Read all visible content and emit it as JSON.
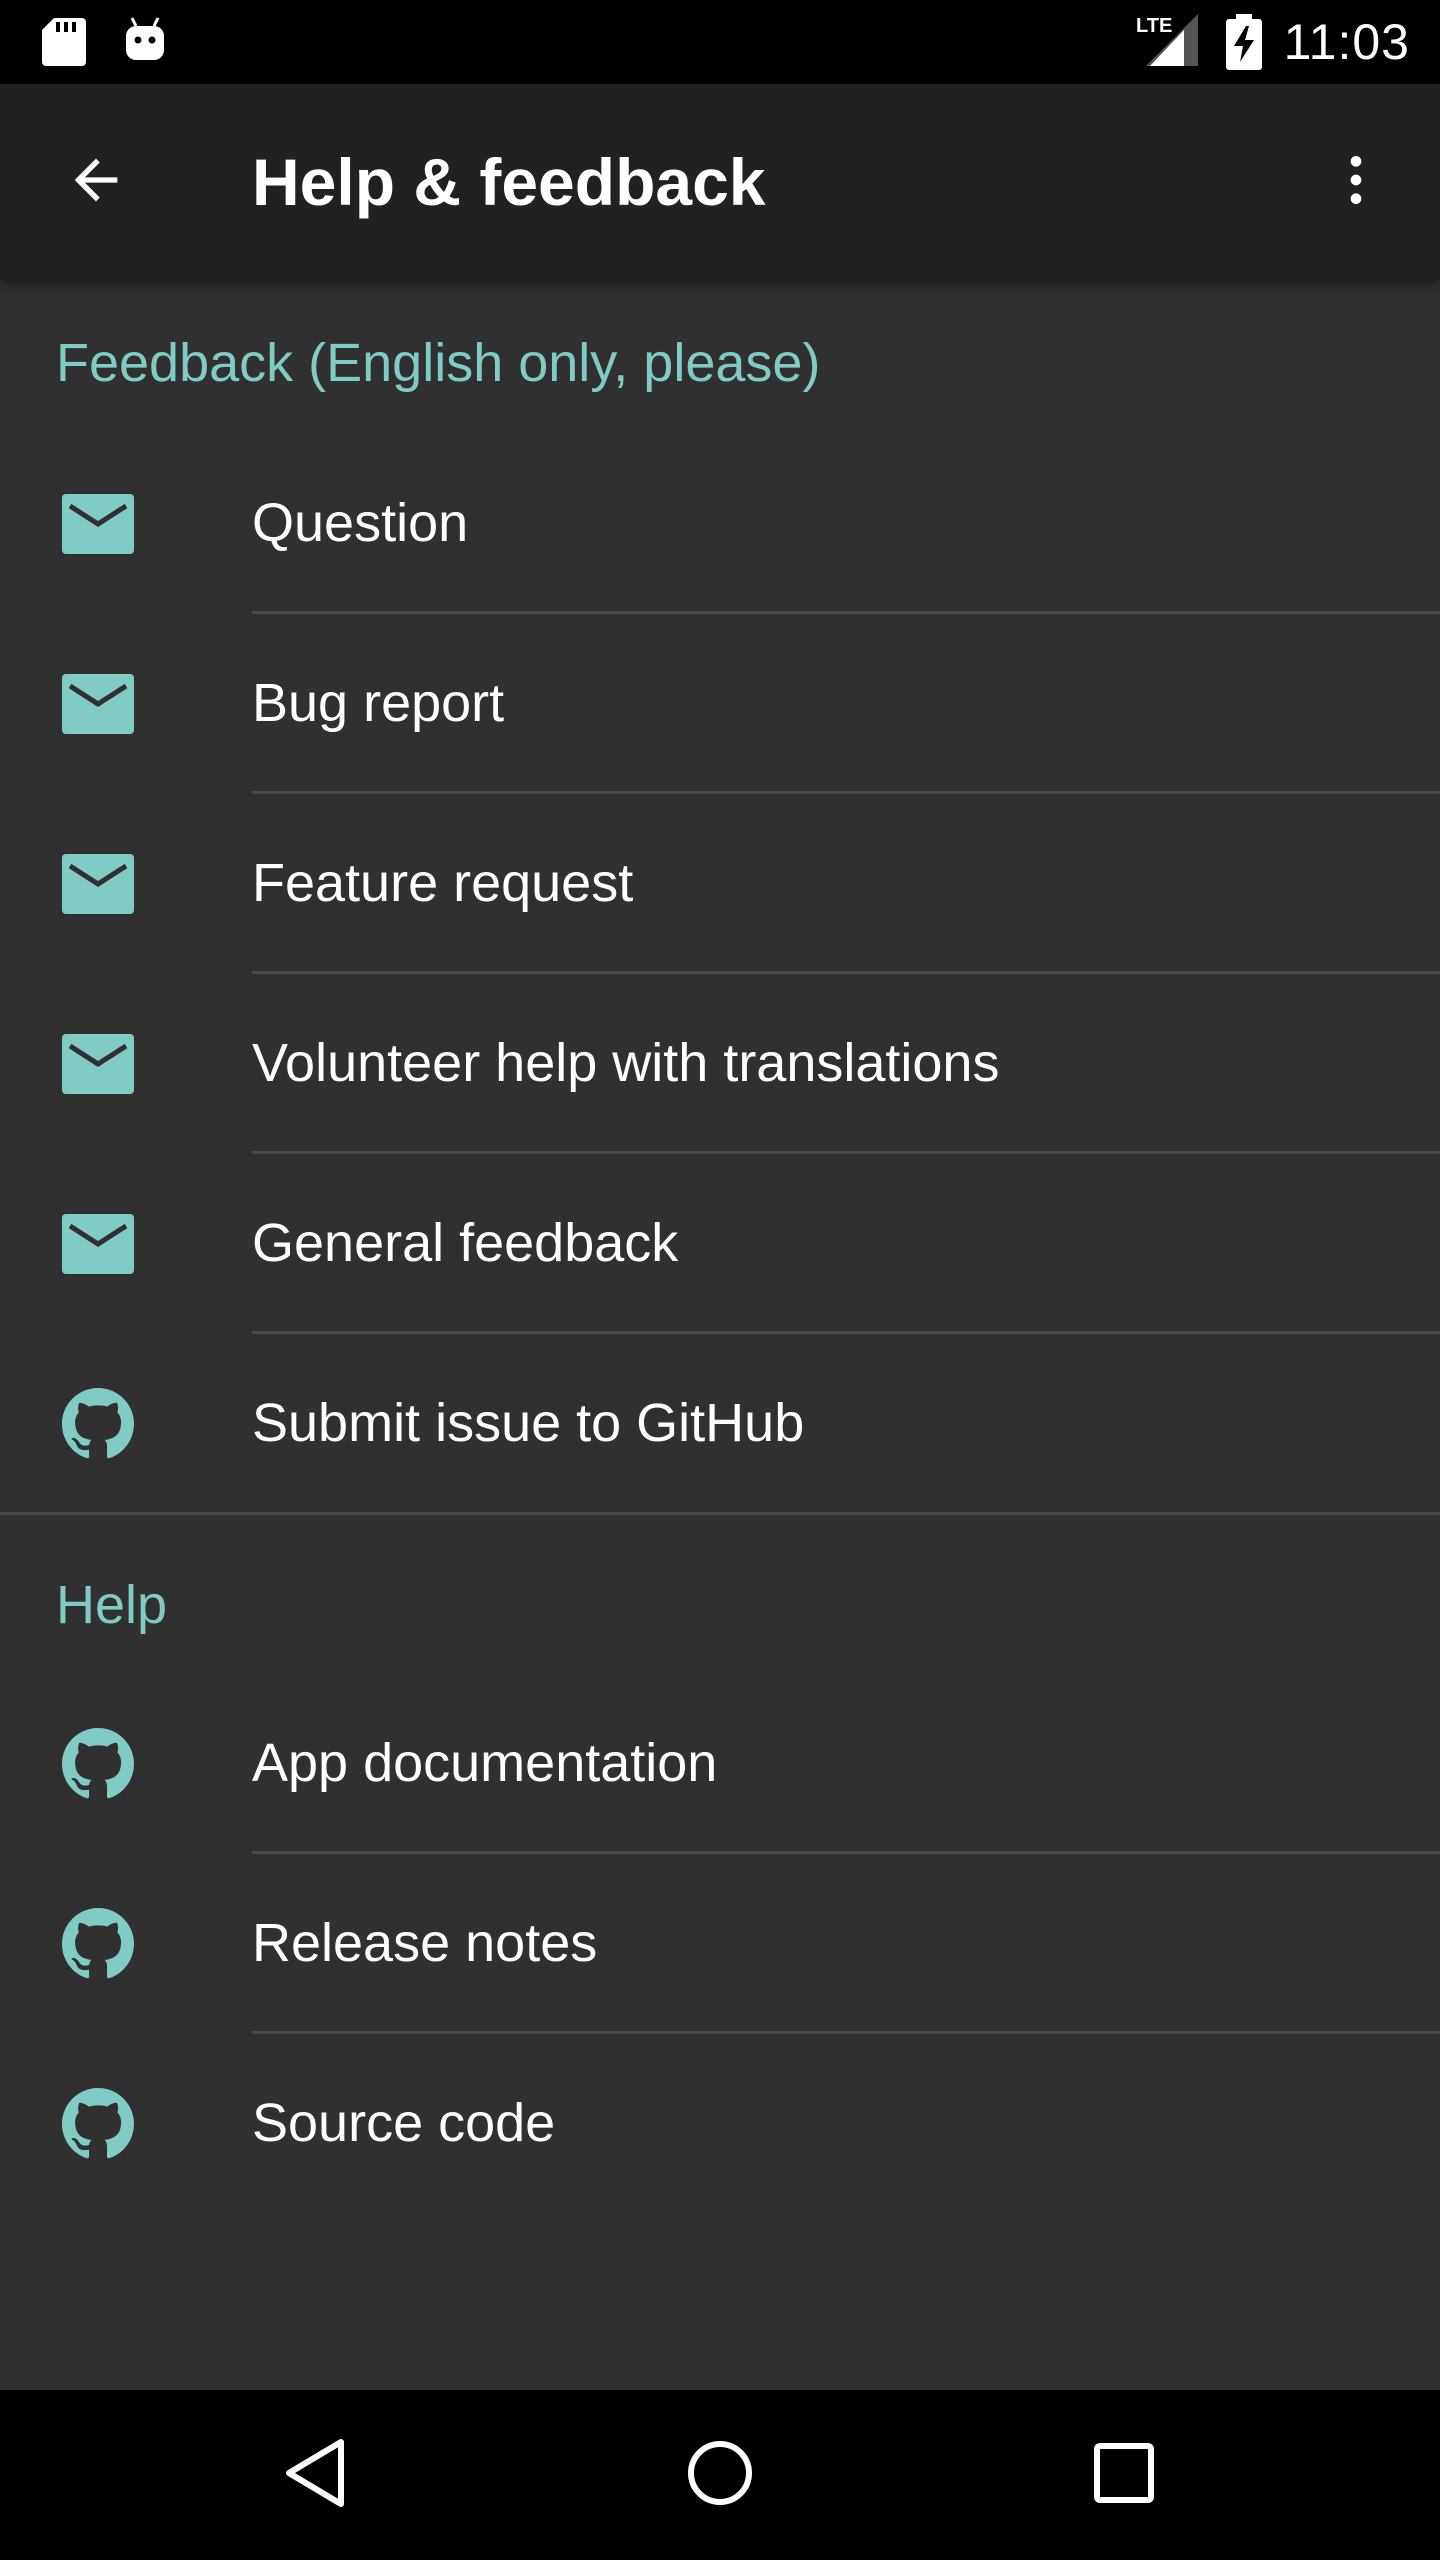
{
  "status_bar": {
    "time": "11:03",
    "network_label": "LTE",
    "icons": [
      "sd-card-icon",
      "android-debug-icon",
      "lte-signal-icon",
      "battery-charging-icon"
    ]
  },
  "app_bar": {
    "title": "Help & feedback",
    "back_icon": "arrow-back-icon",
    "overflow_icon": "more-vert-icon"
  },
  "feedback_section": {
    "header": "Feedback (English only, please)",
    "items": [
      {
        "label": "Question",
        "icon": "email-icon"
      },
      {
        "label": "Bug report",
        "icon": "email-icon"
      },
      {
        "label": "Feature request",
        "icon": "email-icon"
      },
      {
        "label": "Volunteer help with translations",
        "icon": "email-icon"
      },
      {
        "label": "General feedback",
        "icon": "email-icon"
      },
      {
        "label": "Submit issue to GitHub",
        "icon": "github-icon"
      }
    ]
  },
  "help_section": {
    "header": "Help",
    "items": [
      {
        "label": "App documentation",
        "icon": "github-icon"
      },
      {
        "label": "Release notes",
        "icon": "github-icon"
      },
      {
        "label": "Source code",
        "icon": "github-icon"
      }
    ]
  },
  "nav_bar": {
    "icons": [
      "nav-back-icon",
      "nav-home-icon",
      "nav-recents-icon"
    ]
  },
  "colors": {
    "accent": "#80cbc4",
    "background": "#303030",
    "app_bar": "#212121",
    "text_primary": "#ffffff",
    "divider": "#484848"
  }
}
